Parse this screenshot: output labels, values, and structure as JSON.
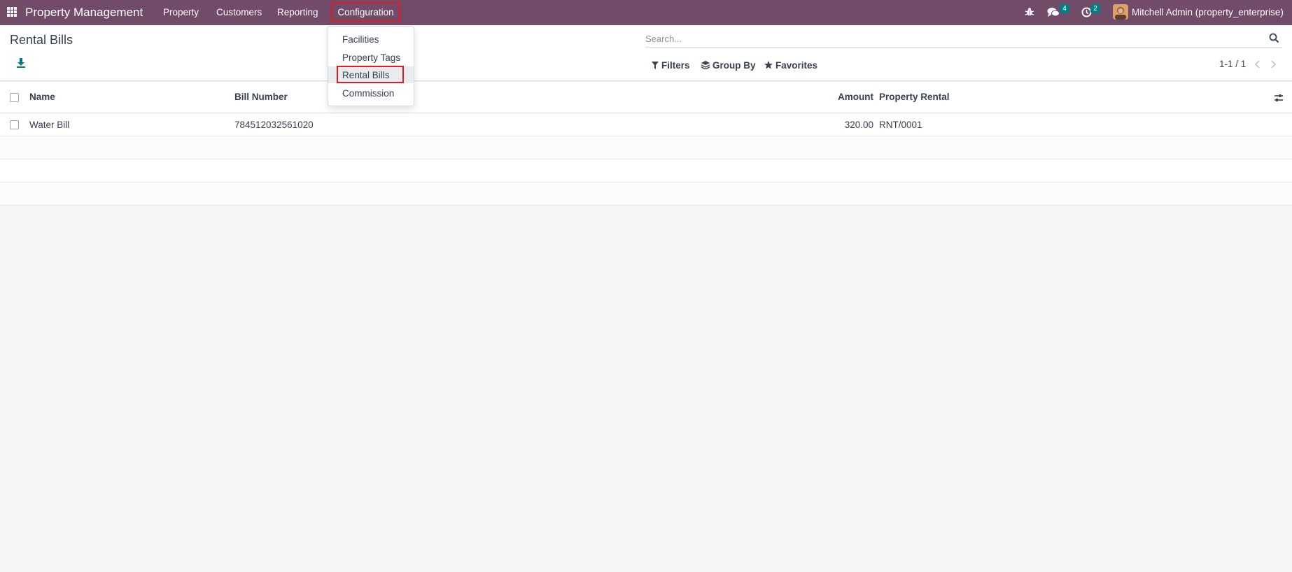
{
  "navbar": {
    "app_name": "Property Management",
    "menus": [
      "Property",
      "Customers",
      "Reporting"
    ],
    "active_menu": "Configuration",
    "chat_badge": "4",
    "activity_badge": "2",
    "user": "Mitchell Admin (property_enterprise)",
    "icons": [
      "apps-icon",
      "bug-icon",
      "chat-icon",
      "clock-icon",
      "avatar"
    ],
    "background_color": "#714b67",
    "highlight_color": "#e01b24",
    "badge_color": "#017e84"
  },
  "dropdown": {
    "items": [
      "Facilities",
      "Property Tags",
      "Rental Bills",
      "Commission"
    ],
    "selected": "Rental Bills"
  },
  "control_panel": {
    "title": "Rental Bills",
    "search_placeholder": "Search...",
    "filters": "Filters",
    "group_by": "Group By",
    "favorites": "Favorites",
    "pager": "1-1 / 1"
  },
  "list": {
    "columns": [
      "Name",
      "Bill Number",
      "Amount",
      "Property Rental"
    ],
    "rows": [
      {
        "name": "Water Bill",
        "bill_number": "784512032561020",
        "amount": "320.00",
        "property_rental": "RNT/0001"
      }
    ]
  }
}
